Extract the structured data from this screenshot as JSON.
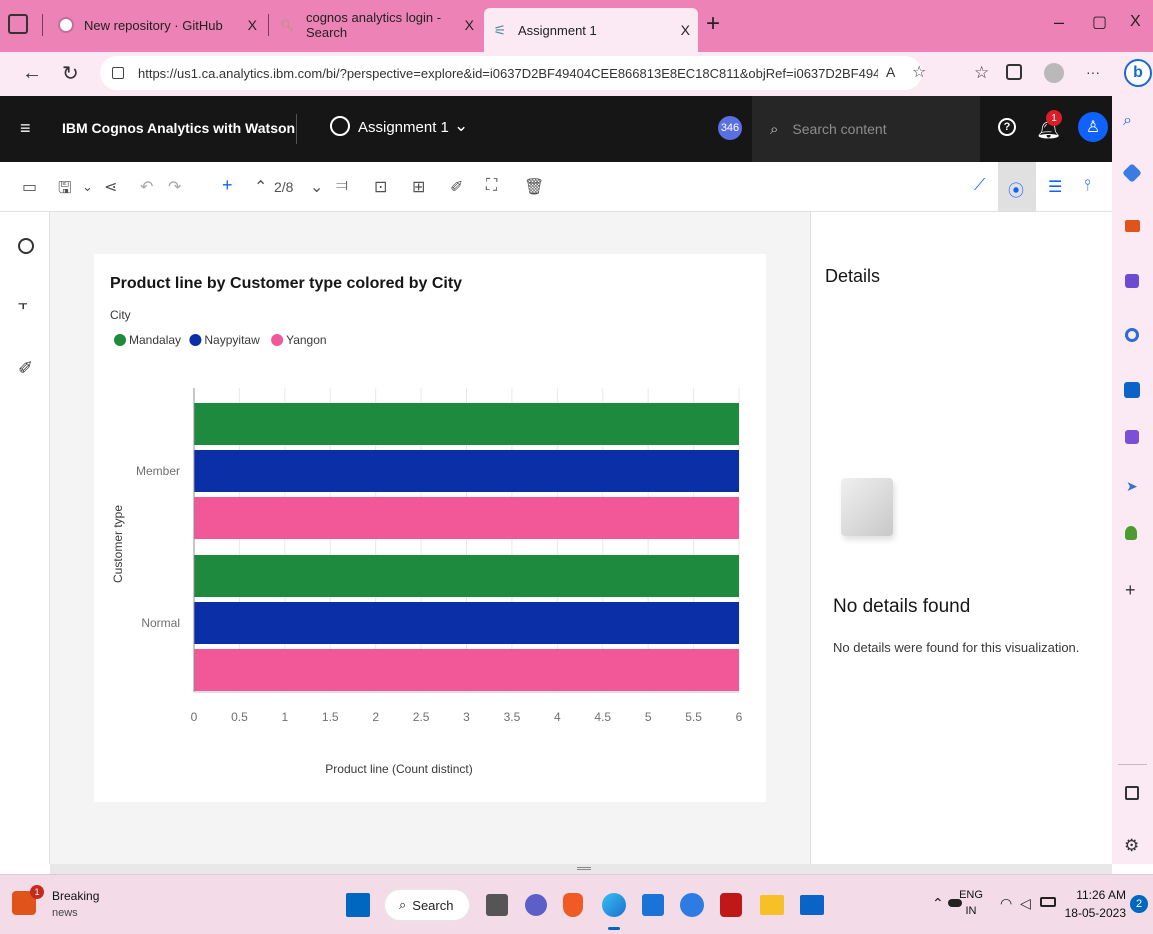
{
  "browser": {
    "tabs": [
      {
        "label": "New repository · GitHub",
        "close": "X"
      },
      {
        "label": "cognos analytics login - Search",
        "close": "X"
      },
      {
        "label": "Assignment 1",
        "close": "X"
      }
    ],
    "new_tab": "+",
    "window_controls": {
      "minimize": "–",
      "restore": "▢",
      "close": "X"
    },
    "url": "https://us1.ca.analytics.ibm.com/bi/?perspective=explore&id=i0637D2BF49404CEE866813E8EC18C811&objRef=i0637D2BF49404C...",
    "read_aloud": "A",
    "more": "···"
  },
  "app": {
    "title": "IBM Cognos Analytics with Watson",
    "report_name": "Assignment 1",
    "badge_count": "346",
    "search_placeholder": "Search content",
    "notification_count": "1"
  },
  "toolbar": {
    "page_indicator": "2/8"
  },
  "chart_data": {
    "type": "bar",
    "orientation": "horizontal",
    "title": "Product line by Customer type colored by City",
    "legend_title": "City",
    "legend_position": "top-left",
    "categories": [
      "Member",
      "Normal"
    ],
    "series": [
      {
        "name": "Mandalay",
        "color": "#1e8a3e",
        "values": [
          6,
          6
        ]
      },
      {
        "name": "Naypyitaw",
        "color": "#0a2fa6",
        "values": [
          6,
          6
        ]
      },
      {
        "name": "Yangon",
        "color": "#f25797",
        "values": [
          6,
          6
        ]
      }
    ],
    "xlabel": "Product line (Count distinct)",
    "ylabel": "Customer type",
    "xlim": [
      0,
      6
    ],
    "xticks": [
      "0",
      "0.5",
      "1",
      "1.5",
      "2",
      "2.5",
      "3",
      "3.5",
      "4",
      "4.5",
      "5",
      "5.5",
      "6"
    ],
    "grid": true
  },
  "details": {
    "heading": "Details",
    "empty_title": "No details found",
    "empty_message": "No details were found for this visualization."
  },
  "taskbar": {
    "news_title": "Breaking",
    "news_sub": "news",
    "news_badge": "1",
    "search_label": "Search",
    "lang_top": "ENG",
    "lang_bottom": "IN",
    "time": "11:26 AM",
    "date": "18-05-2023",
    "notif_count": "2"
  }
}
